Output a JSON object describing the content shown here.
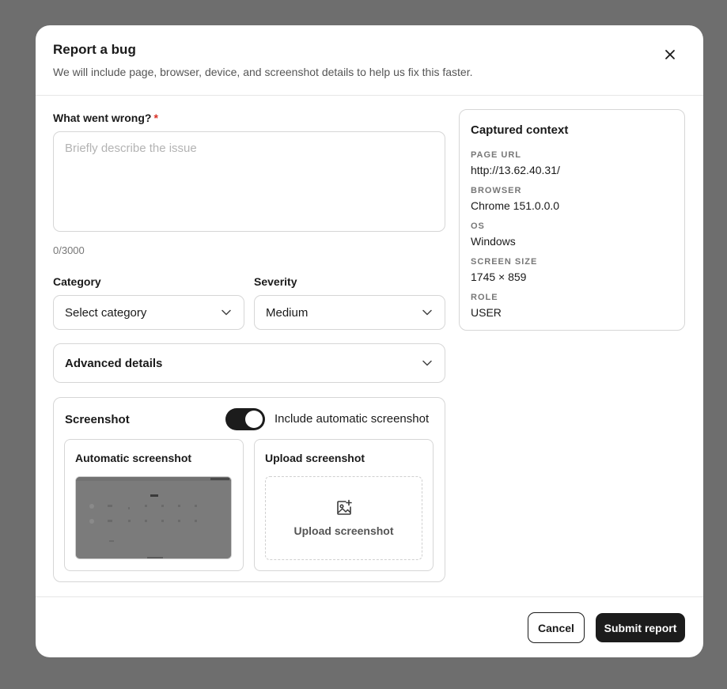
{
  "dialog": {
    "title": "Report a bug",
    "subtitle": "We will include page, browser, device, and screenshot details to help us fix this faster.",
    "close_icon": "close-icon"
  },
  "form": {
    "description_label": "What went wrong?",
    "required_marker": "*",
    "description_placeholder": "Briefly describe the issue",
    "description_value": "",
    "char_count": "0/3000",
    "category_label": "Category",
    "category_value": "Select category",
    "severity_label": "Severity",
    "severity_value": "Medium",
    "advanced_label": "Advanced details"
  },
  "screenshot": {
    "title": "Screenshot",
    "toggle_on": true,
    "toggle_label": "Include automatic screenshot",
    "auto_title": "Automatic screenshot",
    "upload_title": "Upload screenshot",
    "upload_cta": "Upload screenshot",
    "upload_icon": "image-plus-icon"
  },
  "context": {
    "title": "Captured context",
    "items": [
      {
        "label": "PAGE URL",
        "value": "http://13.62.40.31/"
      },
      {
        "label": "BROWSER",
        "value": "Chrome 151.0.0.0"
      },
      {
        "label": "OS",
        "value": "Windows"
      },
      {
        "label": "SCREEN SIZE",
        "value": "1745 × 859"
      },
      {
        "label": "ROLE",
        "value": "USER"
      }
    ]
  },
  "footer": {
    "cancel_label": "Cancel",
    "submit_label": "Submit report"
  },
  "colors": {
    "primary": "#1c1c1c",
    "required": "#d93025",
    "backdrop": "#6e6e6e"
  }
}
